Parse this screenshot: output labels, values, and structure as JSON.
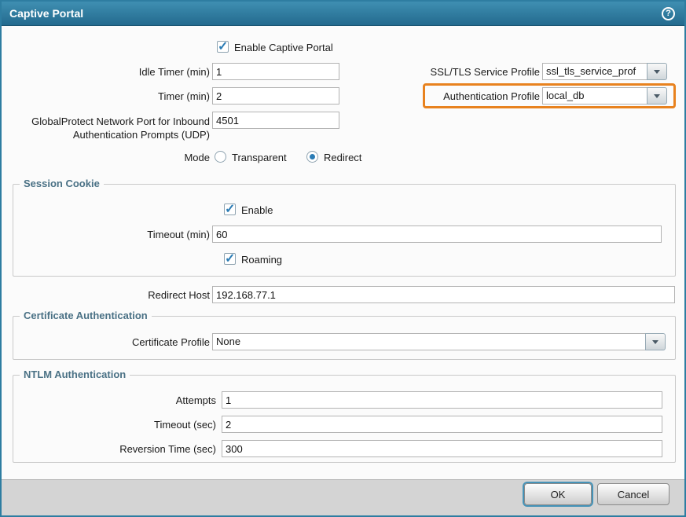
{
  "colors": {
    "titlebar_teal": "#2e7da1",
    "accent_orange": "#e8821e",
    "check_blue": "#2b7cb5"
  },
  "titlebar": {
    "title": "Captive Portal",
    "help_icon": "?"
  },
  "general": {
    "enable_label": "Enable Captive Portal",
    "enable_checked": true,
    "idle_timer_label": "Idle Timer (min)",
    "idle_timer_value": "1",
    "timer_label": "Timer (min)",
    "timer_value": "2",
    "gp_port_label": "GlobalProtect Network Port for Inbound Authentication Prompts (UDP)",
    "gp_port_value": "4501",
    "ssl_label": "SSL/TLS Service Profile",
    "ssl_value": "ssl_tls_service_prof",
    "auth_label": "Authentication Profile",
    "auth_value": "local_db",
    "mode_label": "Mode",
    "mode_options": [
      {
        "label": "Transparent",
        "selected": false
      },
      {
        "label": "Redirect",
        "selected": true
      }
    ]
  },
  "session_cookie": {
    "legend": "Session Cookie",
    "enable_label": "Enable",
    "enable_checked": true,
    "timeout_label": "Timeout (min)",
    "timeout_value": "60",
    "roaming_label": "Roaming",
    "roaming_checked": true
  },
  "redirect_host": {
    "label": "Redirect Host",
    "value": "192.168.77.1"
  },
  "certificate_auth": {
    "legend": "Certificate Authentication",
    "profile_label": "Certificate Profile",
    "profile_value": "None"
  },
  "ntlm": {
    "legend": "NTLM Authentication",
    "attempts_label": "Attempts",
    "attempts_value": "1",
    "timeout_label": "Timeout (sec)",
    "timeout_value": "2",
    "reversion_label": "Reversion Time (sec)",
    "reversion_value": "300"
  },
  "footer": {
    "ok_label": "OK",
    "cancel_label": "Cancel"
  }
}
